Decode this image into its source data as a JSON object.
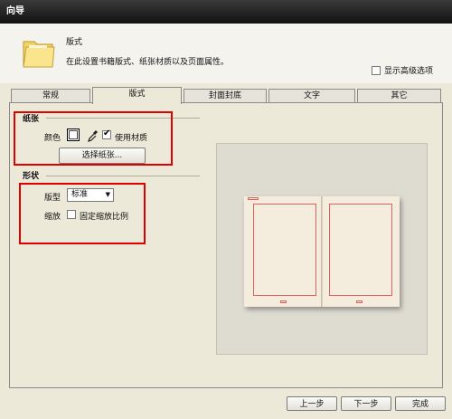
{
  "window": {
    "title": "向导"
  },
  "header": {
    "title": "版式",
    "description": "在此设置书籍版式、纸张材质以及页面属性。",
    "advanced_label": "显示高级选项"
  },
  "tabs": [
    {
      "label": "常规"
    },
    {
      "label": "版式"
    },
    {
      "label": "封面封底"
    },
    {
      "label": "文字"
    },
    {
      "label": "其它"
    }
  ],
  "paper": {
    "group_label": "纸张",
    "color_label": "颜色",
    "use_texture_label": "使用材质",
    "select_paper_button": "选择纸张..."
  },
  "shape": {
    "group_label": "形状",
    "layout_label": "版型",
    "layout_value": "标准",
    "zoom_label": "缩放",
    "fixed_ratio_label": "固定缩放比例"
  },
  "footer": {
    "prev_button": "上一步",
    "next_button": "下一步",
    "finish_button": "完成"
  },
  "colors": {
    "highlight": "#e10000",
    "page_margin": "#e06060"
  }
}
